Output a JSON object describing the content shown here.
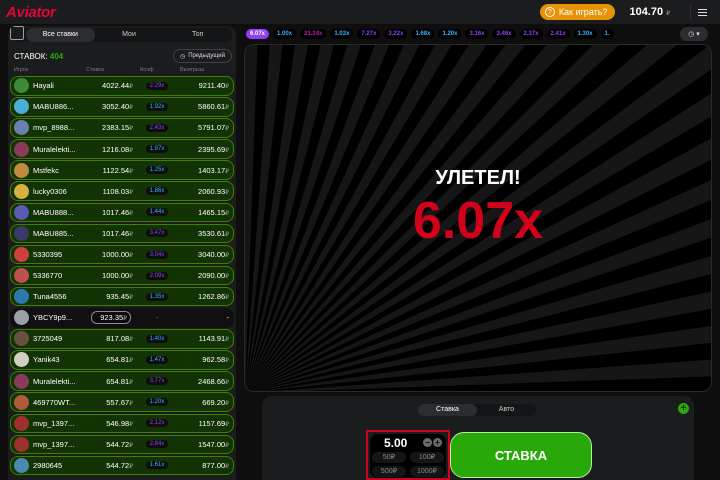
{
  "header": {
    "logo": "Aviator",
    "how_to_play": "Как играть?",
    "balance": "104.70",
    "currency": "₽"
  },
  "left_panel": {
    "tabs": [
      "Все ставки",
      "Мои",
      "Топ"
    ],
    "bets_label": "СТАВОК:",
    "bets_count": "404",
    "previous_button": "Предыдущий",
    "columns": [
      "Игрок",
      "Ставка",
      "Коэф",
      "Выигрыш"
    ],
    "rows": [
      {
        "name": "Hayali",
        "bet": "4022.44",
        "coef": "2.29x",
        "win": "9211.40",
        "coef_color": "#913ef8",
        "avatar": "#3e8a3a",
        "won": true
      },
      {
        "name": "MABU886...",
        "bet": "3052.40",
        "coef": "1.92x",
        "win": "5860.61",
        "coef_color": "#34b4ff",
        "avatar": "#4ab0d6",
        "won": true
      },
      {
        "name": "mvp_8988...",
        "bet": "2383.15",
        "coef": "2.43x",
        "win": "5791.07",
        "coef_color": "#913ef8",
        "avatar": "#6a7fb0",
        "won": true
      },
      {
        "name": "Muralelekti...",
        "bet": "1216.08",
        "coef": "1.97x",
        "win": "2395.69",
        "coef_color": "#34b4ff",
        "avatar": "#8a3a5a",
        "won": true
      },
      {
        "name": "Mstfekc",
        "bet": "1122.54",
        "coef": "1.25x",
        "win": "1403.17",
        "coef_color": "#34b4ff",
        "avatar": "#c08a40",
        "won": true
      },
      {
        "name": "lucky0306",
        "bet": "1108.03",
        "coef": "1.86x",
        "win": "2060.93",
        "coef_color": "#34b4ff",
        "avatar": "#d6b040",
        "won": true
      },
      {
        "name": "MABU888...",
        "bet": "1017.46",
        "coef": "1.44x",
        "win": "1465.15",
        "coef_color": "#34b4ff",
        "avatar": "#5a5ab0",
        "won": true
      },
      {
        "name": "MABU885...",
        "bet": "1017.46",
        "coef": "3.47x",
        "win": "3530.61",
        "coef_color": "#913ef8",
        "avatar": "#3a3a6a",
        "won": true
      },
      {
        "name": "5330395",
        "bet": "1000.00",
        "coef": "3.04x",
        "win": "3040.00",
        "coef_color": "#913ef8",
        "avatar": "#d04040",
        "won": true
      },
      {
        "name": "5336770",
        "bet": "1000.00",
        "coef": "2.09x",
        "win": "2090.00",
        "coef_color": "#913ef8",
        "avatar": "#c05050",
        "won": true
      },
      {
        "name": "Tuna4556",
        "bet": "935.45",
        "coef": "1.35x",
        "win": "1262.86",
        "coef_color": "#34b4ff",
        "avatar": "#2a7ab0",
        "won": true
      },
      {
        "name": "YBCY9p9...",
        "bet": "923.35",
        "coef": "-",
        "win": "-",
        "coef_color": "#9ea0a3",
        "avatar": "#9aa0a6",
        "won": false
      },
      {
        "name": "3725049",
        "bet": "817.08",
        "coef": "1.40x",
        "win": "1143.91",
        "coef_color": "#34b4ff",
        "avatar": "#6a5040",
        "won": true
      },
      {
        "name": "Yanik43",
        "bet": "654.81",
        "coef": "1.47x",
        "win": "962.58",
        "coef_color": "#34b4ff",
        "avatar": "#d0d0c0",
        "won": true
      },
      {
        "name": "Muralelekti...",
        "bet": "654.81",
        "coef": "3.77x",
        "win": "2468.66",
        "coef_color": "#913ef8",
        "avatar": "#8a3a5a",
        "won": true
      },
      {
        "name": "469770WT...",
        "bet": "557.67",
        "coef": "1.20x",
        "win": "669.20",
        "coef_color": "#34b4ff",
        "avatar": "#b05a3a",
        "won": true
      },
      {
        "name": "mvp_1397...",
        "bet": "546.98",
        "coef": "2.12x",
        "win": "1157.69",
        "coef_color": "#913ef8",
        "avatar": "#a03030",
        "won": true
      },
      {
        "name": "mvp_1397...",
        "bet": "544.72",
        "coef": "2.84x",
        "win": "1547.00",
        "coef_color": "#913ef8",
        "avatar": "#a03030",
        "won": true
      },
      {
        "name": "2980645",
        "bet": "544.72",
        "coef": "1.61x",
        "win": "877.00",
        "coef_color": "#34b4ff",
        "avatar": "#4a8ab0",
        "won": true
      }
    ]
  },
  "history": {
    "multipliers": [
      {
        "v": "6.07x",
        "c": "#913ef8"
      },
      {
        "v": "1.00x",
        "c": "#34b4ff"
      },
      {
        "v": "21.24x",
        "c": "#c017b4"
      },
      {
        "v": "1.03x",
        "c": "#34b4ff"
      },
      {
        "v": "7.27x",
        "c": "#913ef8"
      },
      {
        "v": "3.22x",
        "c": "#913ef8"
      },
      {
        "v": "1.68x",
        "c": "#34b4ff"
      },
      {
        "v": "1.20x",
        "c": "#34b4ff"
      },
      {
        "v": "3.16x",
        "c": "#913ef8"
      },
      {
        "v": "3.46x",
        "c": "#913ef8"
      },
      {
        "v": "2.37x",
        "c": "#913ef8"
      },
      {
        "v": "2.41x",
        "c": "#913ef8"
      },
      {
        "v": "1.30x",
        "c": "#34b4ff"
      },
      {
        "v": "1.",
        "c": "#34b4ff"
      }
    ]
  },
  "game": {
    "status": "УЛЕТЕЛ!",
    "crash_value": "6.07x"
  },
  "bet_panel": {
    "tabs": [
      "Ставка",
      "Авто"
    ],
    "amount": "5.00",
    "quick_amounts": [
      "50₽",
      "100₽",
      "500₽",
      "1000₽"
    ],
    "bet_button": "СТАВКА"
  },
  "colors": {
    "accent_red": "#d0021b",
    "win_green": "#28a909",
    "blue": "#34b4ff",
    "purple": "#913ef8"
  }
}
